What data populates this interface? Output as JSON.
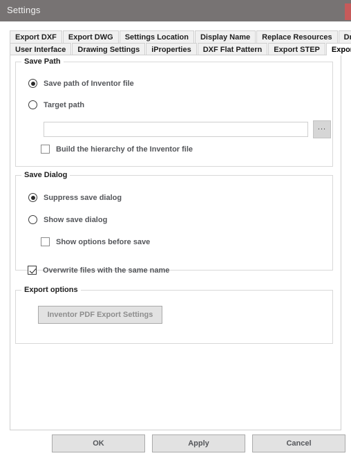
{
  "window": {
    "title": "Settings",
    "close_label": "",
    "titlebar_color": "#777373",
    "close_color": "#c65a5a"
  },
  "tabs": {
    "row1": [
      {
        "label": "Export DXF",
        "active": false
      },
      {
        "label": "Export DWG",
        "active": false
      },
      {
        "label": "Settings Location",
        "active": false
      },
      {
        "label": "Display Name",
        "active": false
      },
      {
        "label": "Replace Resources",
        "active": false
      },
      {
        "label": "Drawing functions",
        "active": false
      }
    ],
    "row2": [
      {
        "label": "User Interface",
        "active": false
      },
      {
        "label": "Drawing Settings",
        "active": false
      },
      {
        "label": "iProperties",
        "active": false
      },
      {
        "label": "DXF Flat Pattern",
        "active": false
      },
      {
        "label": "Export STEP",
        "active": false
      },
      {
        "label": "Export PDF",
        "active": true
      }
    ]
  },
  "save_path": {
    "group_title": "Save Path",
    "radio_inventor_file": "Save path of Inventor file",
    "radio_inventor_file_checked": true,
    "radio_target_path": "Target path",
    "radio_target_path_checked": false,
    "path_value": "",
    "path_placeholder": "",
    "browse_label": "...",
    "check_build_hierarchy": "Build the hierarchy of the Inventor file",
    "check_build_hierarchy_checked": false
  },
  "save_dialog": {
    "group_title": "Save Dialog",
    "radio_suppress": "Suppress save dialog",
    "radio_suppress_checked": true,
    "radio_show": "Show save dialog",
    "radio_show_checked": false,
    "check_show_options": "Show options before save",
    "check_show_options_checked": false,
    "check_overwrite": "Overwrite files with the same name",
    "check_overwrite_checked": true
  },
  "export_options": {
    "group_title": "Export options",
    "inventor_settings_button": "Inventor PDF Export Settings"
  },
  "footer": {
    "ok": "OK",
    "apply": "Apply",
    "cancel": "Cancel"
  }
}
